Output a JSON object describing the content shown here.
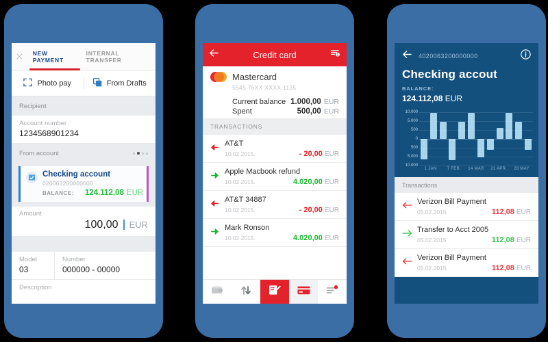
{
  "page": {
    "background": "#000000",
    "phone_body_color": "#3a6ea5"
  },
  "phone1": {
    "name": "new-payment-screen",
    "close_icon": "close-icon",
    "tabs": [
      {
        "label": "NEW PAYMENT",
        "active": true
      },
      {
        "label": "INTERNAL TRANSFER",
        "active": false
      }
    ],
    "actions": [
      {
        "label": "Photo pay",
        "icon": "photo-frame-icon"
      },
      {
        "label": "From Drafts",
        "icon": "stacked-squares-icon"
      }
    ],
    "recipient_section": "Recipient",
    "account_number_label": "Account number",
    "account_number_value": "1234568901234",
    "from_account_section": "From account",
    "carousel_dots": 4,
    "carousel_active_index": 1,
    "account_card": {
      "name": "Checking account",
      "number": "020063200000000",
      "balance_label": "BALANCE:",
      "balance_value": "124.112,08",
      "balance_currency": "EUR",
      "accent_left": "#1f7fd4",
      "accent_right": "#b858c4",
      "balance_color": "#22c03c"
    },
    "amount_label": "Amount",
    "amount_value": "100,00",
    "amount_currency": "EUR",
    "model_label": "Model",
    "model_value": "03",
    "number_label": "Number",
    "number_value": "000000 - 00000",
    "description_label": "Description",
    "accent": "#d8232a"
  },
  "phone2": {
    "name": "credit-card-screen",
    "header": {
      "back_icon": "back-arrow-icon",
      "title": "Credit card",
      "right_icon": "list-info-icon",
      "background": "#e4222b"
    },
    "card": {
      "logo_icon": "mastercard-icon",
      "brand": "Mastercard",
      "pan": "5545 76XX XXXX 1135",
      "rows": [
        {
          "label": "Current balance",
          "value": "1.000,00",
          "currency": "EUR"
        },
        {
          "label": "Spent",
          "value": "500,00",
          "currency": "EUR"
        }
      ]
    },
    "transactions_section": "TRANSACTIONS",
    "transactions": [
      {
        "name": "AT&T",
        "date": "10.02.2015.",
        "amount": "- 20,00",
        "currency": "EUR",
        "direction": "out"
      },
      {
        "name": "Apple Macbook refund",
        "date": "10.02.2015.",
        "amount": "4.020,00",
        "currency": "EUR",
        "direction": "in"
      },
      {
        "name": "AT&T 34887",
        "date": "10.02.2015.",
        "amount": "- 20,00",
        "currency": "EUR",
        "direction": "out"
      },
      {
        "name": "Mark Ronson",
        "date": "10.02.2015.",
        "amount": "4.020,00",
        "currency": "EUR",
        "direction": "in"
      }
    ],
    "nav": [
      {
        "icon": "wallet-icon",
        "state": "inactive"
      },
      {
        "icon": "transfer-arrows-icon",
        "state": "inactive"
      },
      {
        "icon": "new-payment-pencil-icon",
        "state": "active"
      },
      {
        "icon": "credit-card-icon",
        "state": "semi"
      },
      {
        "icon": "list-notification-icon",
        "state": "inactive",
        "badge": true
      }
    ],
    "colors": {
      "negative": "#e4222b",
      "positive": "#19b62f"
    }
  },
  "phone3": {
    "name": "checking-account-screen",
    "header": {
      "back_icon": "back-arrow-icon",
      "account_number": "4020063200000000",
      "info_icon": "info-circle-icon",
      "title": "Checking accout",
      "balance_label": "BALANCE:",
      "balance_value": "124.112,08",
      "balance_currency": "EUR",
      "background": "#14507d"
    },
    "transactions_section": "Transactions",
    "transactions": [
      {
        "name": "Verizon Bill Payment",
        "date": "05.02.2015",
        "amount": "112,08",
        "currency": "EUR",
        "direction": "out"
      },
      {
        "name": "Transfer to Acct 2005",
        "date": "05.02.2015",
        "amount": "112,08",
        "currency": "EUR",
        "direction": "in"
      },
      {
        "name": "Verizon Bill Payment",
        "date": "05.02.2015",
        "amount": "112,08",
        "currency": "EUR",
        "direction": "out"
      }
    ],
    "colors": {
      "negative": "#e8393f",
      "positive": "#35c14a"
    }
  },
  "chart_data": {
    "type": "bar",
    "title": "",
    "xlabel": "",
    "ylabel": "",
    "grid": true,
    "bar_color": "#a8d4ec",
    "ytick_labels": [
      "10.000",
      "5.000",
      "500",
      "0",
      "500",
      "5.000",
      "10.000"
    ],
    "ytick_values": [
      10000,
      5000,
      500,
      0,
      -500,
      -5000,
      -10000
    ],
    "ylim": [
      -10000,
      10000
    ],
    "x": [
      "1 JAN",
      "7 FEB",
      "14 MAR",
      "21 APR.",
      "28 MAY"
    ],
    "categories": [
      "1",
      "2",
      "3",
      "4",
      "5",
      "6",
      "7",
      "8",
      "9",
      "10",
      "11",
      "12"
    ],
    "values": [
      -6500,
      9500,
      4500,
      -7000,
      4500,
      9500,
      -5500,
      -1500,
      1500,
      9500,
      4500,
      -1500
    ]
  }
}
